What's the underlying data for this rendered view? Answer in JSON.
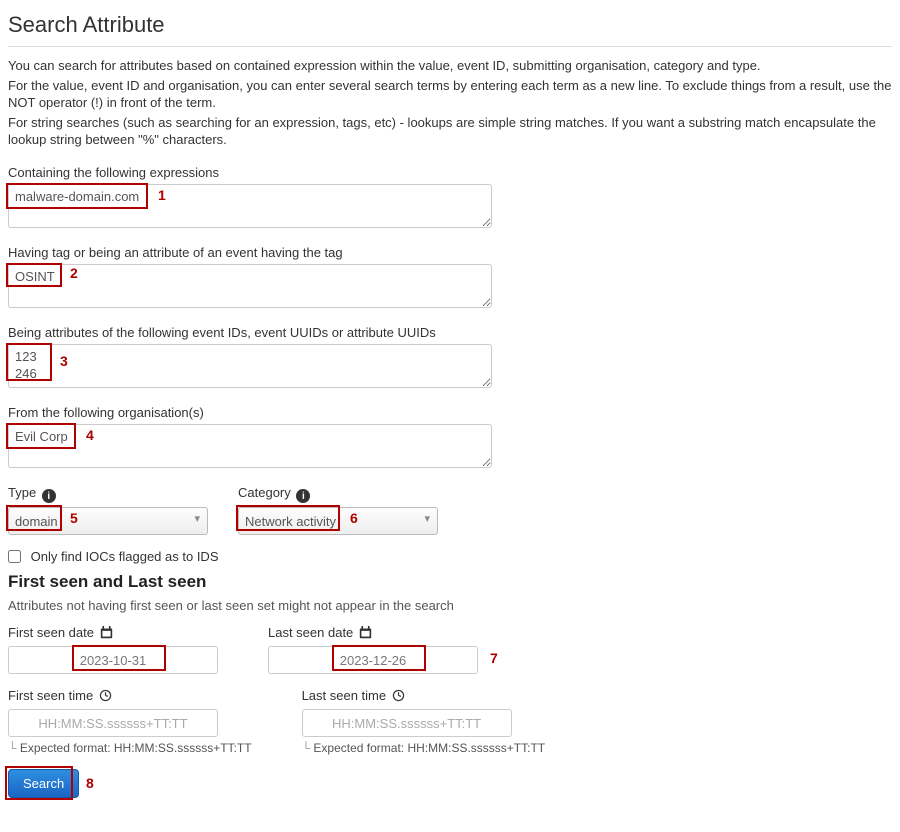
{
  "title": "Search Attribute",
  "help": {
    "line1": "You can search for attributes based on contained expression within the value, event ID, submitting organisation, category and type.",
    "line2": "For the value, event ID and organisation, you can enter several search terms by entering each term as a new line. To exclude things from a result, use the NOT operator (!) in front of the term.",
    "line3": "For string searches (such as searching for an expression, tags, etc) - lookups are simple string matches. If you want a substring match encapsulate the lookup string between \"%\" characters."
  },
  "fields": {
    "expressions": {
      "label": "Containing the following expressions",
      "value": "malware-domain.com"
    },
    "tags": {
      "label": "Having tag or being an attribute of an event having the tag",
      "value": "OSINT"
    },
    "ids": {
      "label": "Being attributes of the following event IDs, event UUIDs or attribute UUIDs",
      "value": "123\n246"
    },
    "orgs": {
      "label": "From the following organisation(s)",
      "value": "Evil Corp"
    }
  },
  "type": {
    "label": "Type",
    "value": "domain"
  },
  "category": {
    "label": "Category",
    "value": "Network activity"
  },
  "ids_checkbox": {
    "label": "Only find IOCs flagged as to IDS",
    "checked": false
  },
  "seen_heading": "First seen and Last seen",
  "seen_subhelp": "Attributes not having first seen or last seen set might not appear in the search",
  "first_seen_date": {
    "label": "First seen date",
    "value": "2023-10-31"
  },
  "last_seen_date": {
    "label": "Last seen date",
    "value": "2023-12-26"
  },
  "first_seen_time": {
    "label": "First seen time",
    "placeholder": "HH:MM:SS.ssssss+TT:TT",
    "hint": "Expected format: HH:MM:SS.ssssss+TT:TT"
  },
  "last_seen_time": {
    "label": "Last seen time",
    "placeholder": "HH:MM:SS.ssssss+TT:TT",
    "hint": "Expected format: HH:MM:SS.ssssss+TT:TT"
  },
  "search_button": "Search",
  "annotations": {
    "1": "1",
    "2": "2",
    "3": "3",
    "4": "4",
    "5": "5",
    "6": "6",
    "7": "7",
    "8": "8"
  }
}
